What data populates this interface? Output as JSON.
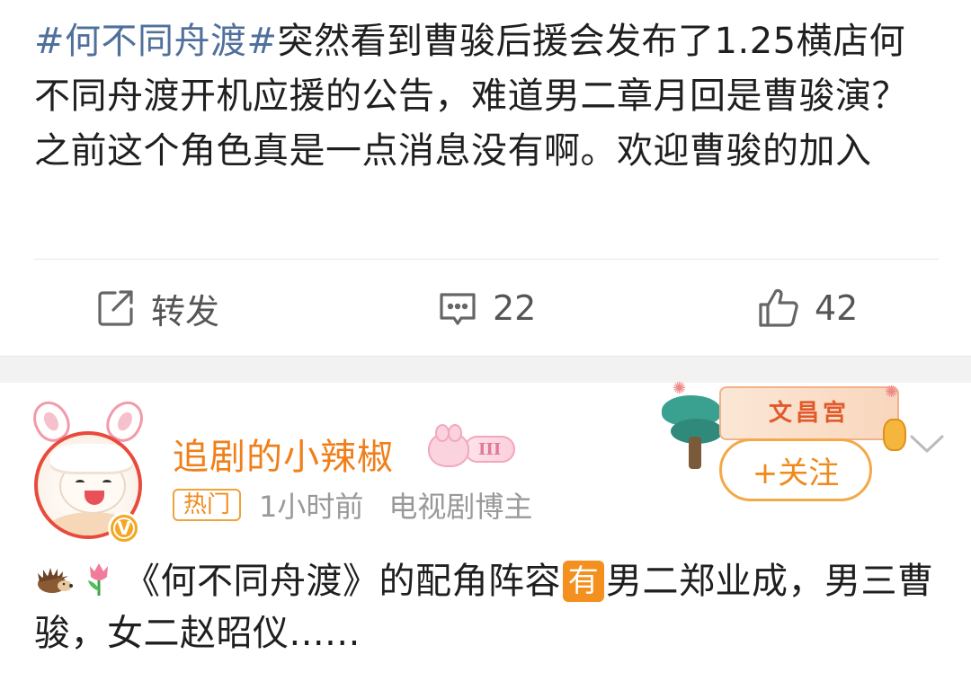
{
  "post1": {
    "hashtag": "#何不同舟渡#",
    "body": "突然看到曹骏后援会发布了1.25横店何不同舟渡开机应援的公告，难道男二章月回是曹骏演？之前这个角色真是一点消息没有啊。欢迎曹骏的加入",
    "actions": {
      "repost_label": "转发",
      "comment_count": "22",
      "like_count": "42"
    }
  },
  "post2": {
    "username": "追剧的小辣椒",
    "level": "III",
    "hot_badge": "热门",
    "time": "1小时前",
    "role": "电视剧博主",
    "verified_mark": "V",
    "decoration_text": "文昌宫",
    "follow_label": "+关注",
    "body_part1": "《何不同舟渡》的配角阵容",
    "you_mark": "有",
    "body_part2": "男二郑业成，男三曹骏，女二赵昭仪......"
  },
  "colors": {
    "hashtag": "#50709c",
    "accent_orange": "#f08a1a",
    "username": "#f07f1a",
    "meta_grey": "#999999"
  },
  "icons": {
    "repost": "repost-icon",
    "comment": "comment-icon",
    "like": "like-icon",
    "chevron": "chevron-down-icon",
    "hedgehog": "hedgehog-emoji",
    "tulip": "tulip-emoji"
  }
}
